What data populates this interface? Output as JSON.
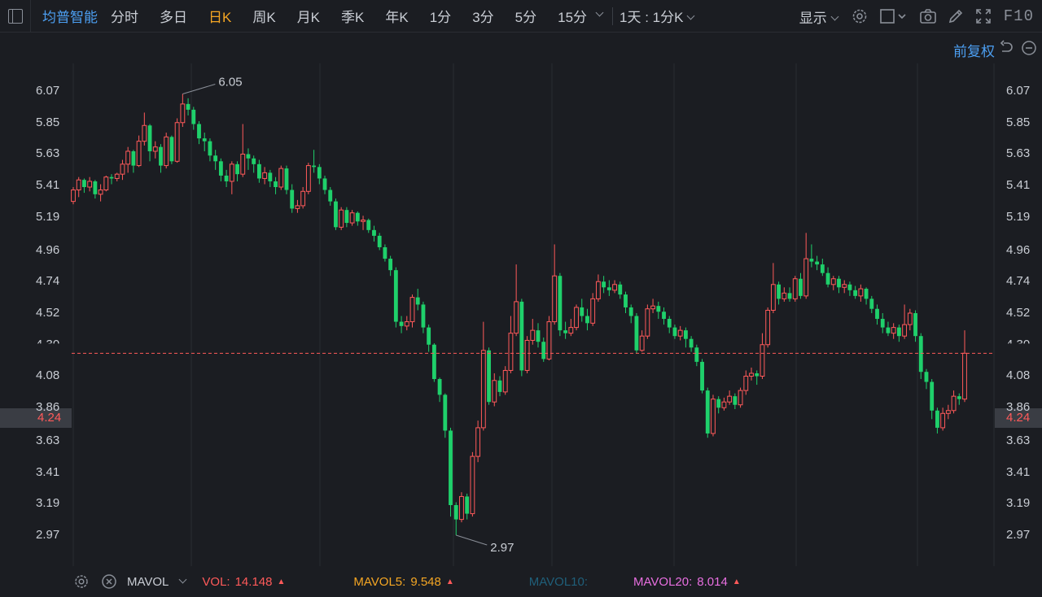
{
  "toolbar": {
    "stock_name": "均普智能",
    "tabs": [
      {
        "label": "分时",
        "active": false
      },
      {
        "label": "多日",
        "active": false
      },
      {
        "label": "日K",
        "active": true
      },
      {
        "label": "周K",
        "active": false
      },
      {
        "label": "月K",
        "active": false
      },
      {
        "label": "季K",
        "active": false
      },
      {
        "label": "年K",
        "active": false
      },
      {
        "label": "1分",
        "active": false
      },
      {
        "label": "3分",
        "active": false
      },
      {
        "label": "5分",
        "active": false
      },
      {
        "label": "15分",
        "active": false
      }
    ],
    "period_select": "1天 : 1分K",
    "display_label": "显示",
    "f10_label": "F10"
  },
  "subbar": {
    "adjust_label": "前复权"
  },
  "chart": {
    "price_ticks": [
      "6.07",
      "5.85",
      "5.63",
      "5.41",
      "5.19",
      "4.96",
      "4.74",
      "4.52",
      "4.30",
      "4.08",
      "3.86",
      "3.63",
      "3.41",
      "3.19",
      "2.97"
    ],
    "current_price": "4.24",
    "high_label": "6.05",
    "low_label": "2.97",
    "up_color": "#ff5a5a",
    "down_color": "#1fd06b"
  },
  "indicator_bar": {
    "name": "MAVOL",
    "vol_label": "VOL:",
    "vol_value": "14.148",
    "mavol5_label": "MAVOL5:",
    "mavol5_value": "9.548",
    "mavol10_label": "MAVOL10:",
    "mavol20_label": "MAVOL20:",
    "mavol20_value": "8.014"
  },
  "chart_data": {
    "type": "candlestick",
    "ylim": [
      2.97,
      6.07
    ],
    "candles": [
      [
        5.3,
        5.38,
        5.4,
        5.28
      ],
      [
        5.38,
        5.45,
        5.47,
        5.33
      ],
      [
        5.45,
        5.4,
        5.46,
        5.36
      ],
      [
        5.4,
        5.44,
        5.47,
        5.37
      ],
      [
        5.44,
        5.35,
        5.45,
        5.32
      ],
      [
        5.35,
        5.38,
        5.42,
        5.3
      ],
      [
        5.38,
        5.47,
        5.48,
        5.37
      ],
      [
        5.47,
        5.46,
        5.49,
        5.42
      ],
      [
        5.46,
        5.49,
        5.5,
        5.44
      ],
      [
        5.49,
        5.56,
        5.59,
        5.45
      ],
      [
        5.56,
        5.65,
        5.68,
        5.5
      ],
      [
        5.65,
        5.55,
        5.66,
        5.5
      ],
      [
        5.55,
        5.72,
        5.76,
        5.54
      ],
      [
        5.72,
        5.83,
        5.92,
        5.69
      ],
      [
        5.83,
        5.65,
        5.84,
        5.58
      ],
      [
        5.65,
        5.68,
        5.72,
        5.6
      ],
      [
        5.68,
        5.55,
        5.7,
        5.5
      ],
      [
        5.55,
        5.75,
        5.78,
        5.53
      ],
      [
        5.75,
        5.58,
        5.76,
        5.56
      ],
      [
        5.58,
        5.85,
        5.88,
        5.57
      ],
      [
        5.85,
        5.98,
        6.05,
        5.82
      ],
      [
        5.98,
        5.94,
        6.02,
        5.9
      ],
      [
        5.94,
        5.84,
        5.96,
        5.8
      ],
      [
        5.84,
        5.74,
        5.86,
        5.7
      ],
      [
        5.74,
        5.72,
        5.78,
        5.65
      ],
      [
        5.72,
        5.62,
        5.74,
        5.58
      ],
      [
        5.62,
        5.58,
        5.66,
        5.52
      ],
      [
        5.58,
        5.48,
        5.6,
        5.44
      ],
      [
        5.48,
        5.44,
        5.52,
        5.4
      ],
      [
        5.44,
        5.56,
        5.58,
        5.35
      ],
      [
        5.56,
        5.49,
        5.58,
        5.44
      ],
      [
        5.49,
        5.63,
        5.84,
        5.47
      ],
      [
        5.63,
        5.6,
        5.67,
        5.52
      ],
      [
        5.6,
        5.56,
        5.62,
        5.5
      ],
      [
        5.56,
        5.46,
        5.59,
        5.43
      ],
      [
        5.46,
        5.5,
        5.54,
        5.42
      ],
      [
        5.5,
        5.44,
        5.52,
        5.4
      ],
      [
        5.44,
        5.4,
        5.47,
        5.35
      ],
      [
        5.4,
        5.53,
        5.55,
        5.38
      ],
      [
        5.53,
        5.38,
        5.55,
        5.35
      ],
      [
        5.38,
        5.25,
        5.42,
        5.22
      ],
      [
        5.25,
        5.27,
        5.31,
        5.22
      ],
      [
        5.27,
        5.37,
        5.4,
        5.25
      ],
      [
        5.37,
        5.55,
        5.57,
        5.35
      ],
      [
        5.55,
        5.54,
        5.66,
        5.5
      ],
      [
        5.54,
        5.46,
        5.56,
        5.42
      ],
      [
        5.46,
        5.38,
        5.48,
        5.35
      ],
      [
        5.38,
        5.3,
        5.4,
        5.27
      ],
      [
        5.3,
        5.12,
        5.32,
        5.1
      ],
      [
        5.12,
        5.24,
        5.26,
        5.1
      ],
      [
        5.24,
        5.15,
        5.26,
        5.12
      ],
      [
        5.15,
        5.22,
        5.24,
        5.13
      ],
      [
        5.22,
        5.16,
        5.23,
        5.13
      ],
      [
        5.16,
        5.17,
        5.2,
        5.1
      ],
      [
        5.17,
        5.1,
        5.18,
        5.08
      ],
      [
        5.1,
        5.06,
        5.13,
        5.02
      ],
      [
        5.06,
        4.98,
        5.08,
        4.96
      ],
      [
        4.98,
        4.9,
        5.0,
        4.88
      ],
      [
        4.9,
        4.82,
        4.92,
        4.78
      ],
      [
        4.82,
        4.46,
        4.84,
        4.42
      ],
      [
        4.46,
        4.43,
        4.5,
        4.38
      ],
      [
        4.43,
        4.46,
        4.5,
        4.4
      ],
      [
        4.46,
        4.63,
        4.65,
        4.42
      ],
      [
        4.63,
        4.58,
        4.69,
        4.54
      ],
      [
        4.58,
        4.42,
        4.6,
        4.38
      ],
      [
        4.42,
        4.3,
        4.44,
        4.25
      ],
      [
        4.3,
        4.06,
        4.31,
        4.04
      ],
      [
        4.06,
        3.95,
        4.07,
        3.9
      ],
      [
        3.95,
        3.7,
        3.96,
        3.65
      ],
      [
        3.7,
        3.18,
        3.72,
        3.1
      ],
      [
        3.18,
        3.08,
        3.2,
        2.97
      ],
      [
        3.08,
        3.24,
        3.27,
        3.06
      ],
      [
        3.24,
        3.12,
        3.26,
        3.08
      ],
      [
        3.12,
        3.52,
        3.55,
        3.1
      ],
      [
        3.52,
        3.72,
        3.77,
        3.48
      ],
      [
        3.72,
        4.26,
        4.46,
        3.7
      ],
      [
        4.26,
        3.9,
        4.28,
        3.88
      ],
      [
        3.9,
        4.05,
        4.1,
        3.87
      ],
      [
        4.05,
        3.97,
        4.08,
        3.94
      ],
      [
        3.97,
        4.12,
        4.15,
        3.95
      ],
      [
        4.12,
        4.38,
        4.5,
        4.1
      ],
      [
        4.38,
        4.6,
        4.86,
        4.36
      ],
      [
        4.6,
        4.12,
        4.62,
        4.08
      ],
      [
        4.12,
        4.33,
        4.36,
        4.1
      ],
      [
        4.33,
        4.4,
        4.48,
        4.3
      ],
      [
        4.4,
        4.32,
        4.45,
        4.28
      ],
      [
        4.32,
        4.2,
        4.35,
        4.18
      ],
      [
        4.2,
        4.46,
        4.5,
        4.19
      ],
      [
        4.46,
        4.78,
        5.0,
        4.44
      ],
      [
        4.78,
        4.4,
        4.8,
        4.36
      ],
      [
        4.4,
        4.38,
        4.46,
        4.34
      ],
      [
        4.38,
        4.42,
        4.48,
        4.36
      ],
      [
        4.42,
        4.56,
        4.58,
        4.4
      ],
      [
        4.56,
        4.5,
        4.62,
        4.46
      ],
      [
        4.5,
        4.45,
        4.55,
        4.4
      ],
      [
        4.45,
        4.62,
        4.66,
        4.43
      ],
      [
        4.62,
        4.74,
        4.79,
        4.6
      ],
      [
        4.74,
        4.7,
        4.78,
        4.66
      ],
      [
        4.7,
        4.68,
        4.75,
        4.64
      ],
      [
        4.68,
        4.72,
        4.75,
        4.66
      ],
      [
        4.72,
        4.65,
        4.74,
        4.62
      ],
      [
        4.65,
        4.56,
        4.67,
        4.52
      ],
      [
        4.56,
        4.5,
        4.58,
        4.45
      ],
      [
        4.5,
        4.26,
        4.52,
        4.24
      ],
      [
        4.26,
        4.36,
        4.4,
        4.25
      ],
      [
        4.36,
        4.55,
        4.58,
        4.34
      ],
      [
        4.55,
        4.57,
        4.62,
        4.52
      ],
      [
        4.57,
        4.53,
        4.6,
        4.48
      ],
      [
        4.53,
        4.48,
        4.56,
        4.44
      ],
      [
        4.48,
        4.42,
        4.5,
        4.38
      ],
      [
        4.42,
        4.36,
        4.44,
        4.34
      ],
      [
        4.36,
        4.4,
        4.43,
        4.33
      ],
      [
        4.4,
        4.34,
        4.42,
        4.28
      ],
      [
        4.34,
        4.28,
        4.36,
        4.25
      ],
      [
        4.28,
        4.18,
        4.3,
        4.15
      ],
      [
        4.18,
        3.98,
        4.2,
        3.96
      ],
      [
        3.98,
        3.68,
        4.0,
        3.65
      ],
      [
        3.68,
        3.92,
        3.95,
        3.66
      ],
      [
        3.92,
        3.86,
        3.94,
        3.82
      ],
      [
        3.86,
        3.9,
        3.93,
        3.84
      ],
      [
        3.9,
        3.94,
        3.98,
        3.88
      ],
      [
        3.94,
        3.88,
        3.96,
        3.85
      ],
      [
        3.88,
        3.98,
        4.0,
        3.86
      ],
      [
        3.98,
        4.08,
        4.12,
        3.95
      ],
      [
        4.08,
        4.1,
        4.14,
        4.05
      ],
      [
        4.1,
        4.08,
        4.12,
        4.02
      ],
      [
        4.08,
        4.3,
        4.38,
        4.06
      ],
      [
        4.3,
        4.54,
        4.56,
        4.28
      ],
      [
        4.54,
        4.72,
        4.87,
        4.52
      ],
      [
        4.72,
        4.62,
        4.74,
        4.58
      ],
      [
        4.62,
        4.66,
        4.7,
        4.6
      ],
      [
        4.66,
        4.62,
        4.7,
        4.6
      ],
      [
        4.62,
        4.76,
        4.78,
        4.6
      ],
      [
        4.76,
        4.64,
        4.8,
        4.62
      ],
      [
        4.64,
        4.9,
        5.08,
        4.62
      ],
      [
        4.9,
        4.88,
        5.0,
        4.84
      ],
      [
        4.88,
        4.86,
        4.92,
        4.82
      ],
      [
        4.86,
        4.8,
        4.9,
        4.78
      ],
      [
        4.8,
        4.72,
        4.84,
        4.7
      ],
      [
        4.72,
        4.76,
        4.78,
        4.68
      ],
      [
        4.76,
        4.7,
        4.78,
        4.66
      ],
      [
        4.7,
        4.72,
        4.75,
        4.66
      ],
      [
        4.72,
        4.68,
        4.74,
        4.64
      ],
      [
        4.68,
        4.64,
        4.71,
        4.62
      ],
      [
        4.64,
        4.69,
        4.72,
        4.6
      ],
      [
        4.69,
        4.62,
        4.7,
        4.58
      ],
      [
        4.62,
        4.55,
        4.64,
        4.52
      ],
      [
        4.55,
        4.48,
        4.58,
        4.44
      ],
      [
        4.48,
        4.42,
        4.52,
        4.38
      ],
      [
        4.42,
        4.38,
        4.46,
        4.36
      ],
      [
        4.38,
        4.42,
        4.45,
        4.34
      ],
      [
        4.42,
        4.36,
        4.44,
        4.32
      ],
      [
        4.36,
        4.44,
        4.58,
        4.34
      ],
      [
        4.44,
        4.52,
        4.55,
        4.4
      ],
      [
        4.52,
        4.36,
        4.54,
        4.32
      ],
      [
        4.36,
        4.11,
        4.38,
        4.06
      ],
      [
        4.11,
        4.04,
        4.13,
        3.99
      ],
      [
        4.04,
        3.84,
        4.06,
        3.78
      ],
      [
        3.84,
        3.72,
        3.86,
        3.68
      ],
      [
        3.72,
        3.82,
        3.86,
        3.7
      ],
      [
        3.82,
        3.84,
        3.88,
        3.78
      ],
      [
        3.84,
        3.94,
        3.98,
        3.82
      ],
      [
        3.94,
        3.92,
        3.96,
        3.88
      ],
      [
        3.92,
        4.24,
        4.4,
        3.9
      ]
    ]
  }
}
